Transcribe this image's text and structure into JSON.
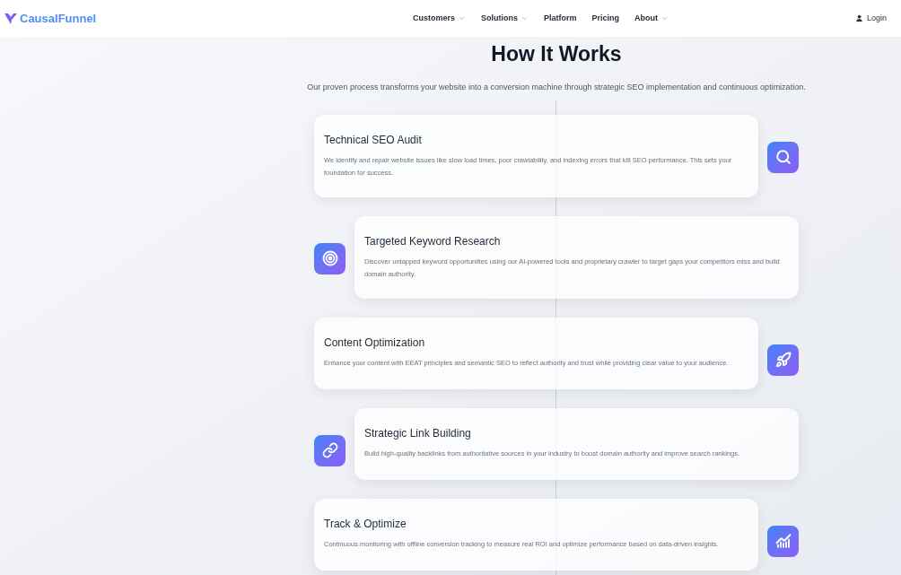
{
  "brand": {
    "name": "CausalFunnel"
  },
  "nav": [
    {
      "label": "Customers",
      "kind": "dropdown"
    },
    {
      "label": "Solutions",
      "kind": "dropdown"
    },
    {
      "label": "Platform",
      "kind": "link"
    },
    {
      "label": "Pricing",
      "kind": "link"
    },
    {
      "label": "About",
      "kind": "dropdown"
    }
  ],
  "login": {
    "label": "Login"
  },
  "section": {
    "title": "How It Works",
    "subtitle": "Our proven process transforms your website into a conversion machine through strategic SEO implementation and continuous optimization."
  },
  "steps": [
    {
      "kind": "icon-right",
      "title": "Technical SEO Audit",
      "description": "We identify and repair website issues like slow load times, poor crawlability, and indexing errors that kill SEO performance. This sets your foundation for success."
    },
    {
      "kind": "icon-left",
      "title": "Targeted Keyword Research",
      "description": "Discover untapped keyword opportunities using our AI-powered tools and proprietary crawler to target gaps your competitors miss and build domain authority."
    },
    {
      "kind": "icon-right",
      "title": "Content Optimization",
      "description": "Enhance your content with EEAT principles and semantic SEO to reflect authority and trust while providing clear value to your audience."
    },
    {
      "kind": "icon-left",
      "title": "Strategic Link Building",
      "description": "Build high-quality backlinks from authoritative sources in your industry to boost domain authority and improve search rankings."
    },
    {
      "kind": "icon-right",
      "title": "Track & Optimize",
      "description": "Continuous monitoring with offline conversion tracking to measure real ROI and optimize performance based on data-driven insights."
    }
  ]
}
